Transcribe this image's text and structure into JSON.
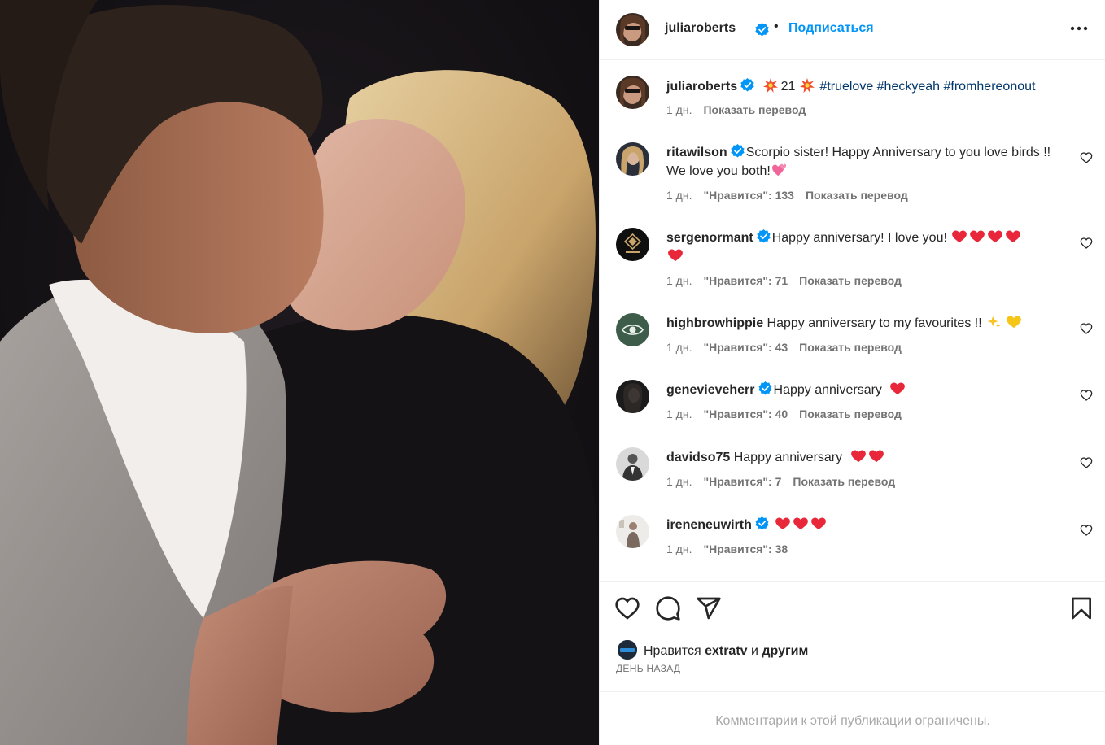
{
  "header": {
    "username": "juliaroberts",
    "separator": "•",
    "follow_label": "Подписаться"
  },
  "caption": {
    "username": "juliaroberts",
    "text_number": "21",
    "hashtags": "#truelove #heckyeah #fromhereonout",
    "time": "1 дн.",
    "translate": "Показать перевод"
  },
  "comments": [
    {
      "username": "ritawilson",
      "verified": true,
      "text": "Scorpio sister! Happy Anniversary to you love birds !! We love you both!",
      "time": "1 дн.",
      "likes": "\"Нравится\": 133",
      "translate": "Показать перевод"
    },
    {
      "username": "sergenormant",
      "verified": true,
      "text": "Happy anniversary! I love you!",
      "time": "1 дн.",
      "likes": "\"Нравится\": 71",
      "translate": "Показать перевод",
      "hearts": 5
    },
    {
      "username": "highbrowhippie",
      "verified": false,
      "text": "Happy anniversary to my favourites !!",
      "time": "1 дн.",
      "likes": "\"Нравится\": 43",
      "translate": "Показать перевод"
    },
    {
      "username": "genevieveherr",
      "verified": true,
      "text": "Happy anniversary",
      "time": "1 дн.",
      "likes": "\"Нравится\": 40",
      "translate": "Показать перевод",
      "hearts": 1
    },
    {
      "username": "davidso75",
      "verified": false,
      "text": "Happy anniversary",
      "time": "1 дн.",
      "likes": "\"Нравится\": 7",
      "translate": "Показать перевод",
      "hearts": 2
    },
    {
      "username": "ireneneuwirth",
      "verified": true,
      "text": "",
      "time": "1 дн.",
      "likes": "\"Нравится\": 38",
      "hearts": 3
    }
  ],
  "likes_summary": {
    "prefix": "Нравится",
    "user": "extratv",
    "conj": "и",
    "others": "другим"
  },
  "time_ago": "ДЕНЬ НАЗАД",
  "comments_limited": "Комментарии к этой публикации ограничены.",
  "colors": {
    "accent": "#0095f6",
    "verified": "#0095f6",
    "heart": "#ed4956",
    "muted": "#737373",
    "hashtag": "#00376b"
  },
  "icons": [
    "more-options-icon",
    "verified-icon",
    "heart-icon",
    "comment-icon",
    "share-icon",
    "bookmark-icon"
  ]
}
